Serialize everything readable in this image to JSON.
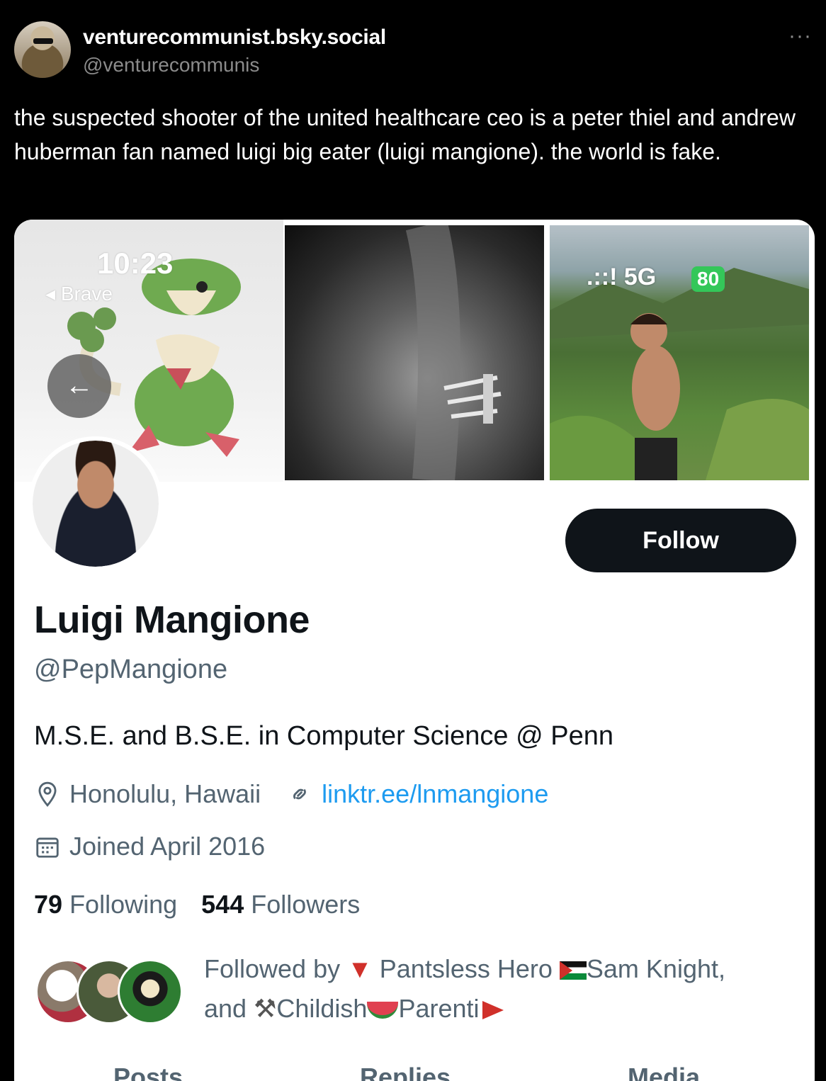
{
  "post": {
    "display_name": "venturecommunist.bsky.social",
    "handle": "@venturecommunis",
    "more": "···",
    "text": "the suspected shooter of the united healthcare ceo is a peter thiel and andrew huberman fan named luigi big eater (luigi mangione). the world is fake."
  },
  "banner": {
    "status_time": "10:23",
    "back_app": "◂ Brave",
    "signal_network": "5G",
    "battery": "80"
  },
  "profile": {
    "name": "Luigi Mangione",
    "handle": "@PepMangione",
    "follow_label": "Follow",
    "bio": "M.S.E. and B.S.E. in Computer Science @ Penn",
    "location": "Honolulu, Hawaii",
    "link": "linktr.ee/lnmangione",
    "joined": "Joined April 2016",
    "following_count": "79",
    "following_label": "Following",
    "followers_count": "544",
    "followers_label": "Followers",
    "followed_by_prefix": "Followed by",
    "follower1": "Pantsless Hero",
    "follower2": "Sam Knight,",
    "and_label": "and",
    "follower3a": "Childish",
    "follower3b": "Parenti"
  },
  "tabs": [
    "Posts",
    "Replies",
    "Media"
  ],
  "colors": {
    "accent_link": "#1d9bf0",
    "secondary_text": "#536471",
    "follow_bg": "#0f1419",
    "battery_green": "#34c759"
  }
}
